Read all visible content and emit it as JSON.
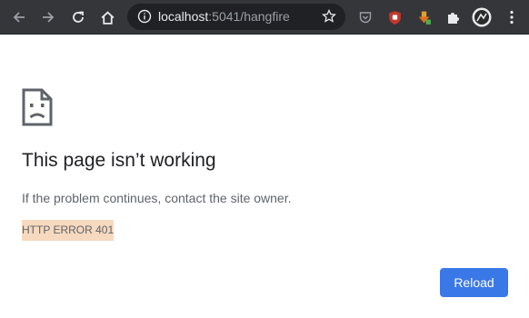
{
  "browser": {
    "url_host": "localhost",
    "url_rest": ":5041/hangfire",
    "icons": [
      "back-arrow-icon",
      "forward-arrow-icon",
      "reload-icon",
      "home-icon",
      "info-icon",
      "star-icon",
      "pocket-icon",
      "ublock-icon",
      "download-extension-icon",
      "extensions-puzzle-icon",
      "profile-avatar-icon",
      "menu-kebab-icon"
    ],
    "colors": {
      "toolbar": "#35363a",
      "omnibox": "#202124"
    }
  },
  "page": {
    "title": "This page isn’t working",
    "description": "If the problem continues, contact the site owner.",
    "error_code": "HTTP ERROR 401",
    "reload_label": "Reload",
    "colors": {
      "button": "#3b78e7",
      "error_highlight": "#f7d9bf"
    }
  }
}
